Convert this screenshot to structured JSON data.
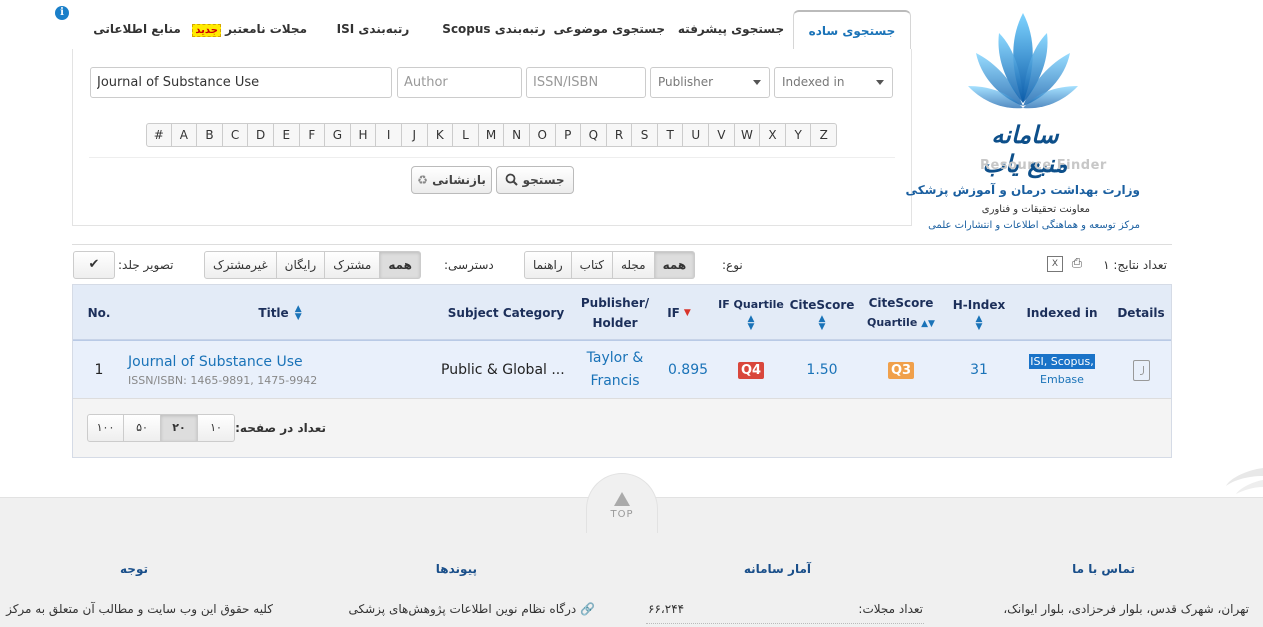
{
  "tabs": [
    {
      "label": "جستجوی ساده",
      "active": true
    },
    {
      "label": "جستجوی پیشرفته"
    },
    {
      "label": "جستجوی موضوعی"
    },
    {
      "label": "رتبه‌بندی Scopus"
    },
    {
      "label": "رتبه‌بندی ISI"
    },
    {
      "label": "مجلات نامعتبر",
      "badge": "جدید"
    },
    {
      "label": "منابع اطلاعاتی"
    }
  ],
  "search": {
    "title_value": "Journal of Substance Use",
    "author_placeholder": "Author",
    "issn_placeholder": "ISSN/ISBN",
    "publisher_label": "Publisher",
    "indexed_label": "Indexed in",
    "alphabet": [
      "#",
      "A",
      "B",
      "C",
      "D",
      "E",
      "F",
      "G",
      "H",
      "I",
      "J",
      "K",
      "L",
      "M",
      "N",
      "O",
      "P",
      "Q",
      "R",
      "S",
      "T",
      "U",
      "V",
      "W",
      "X",
      "Y",
      "Z"
    ],
    "search_button": "جستجو",
    "reset_button": "بازنشانی"
  },
  "logo": {
    "title": "سامانه منبع یاب",
    "english": "Resource Finder",
    "line1": "وزارت بهداشت درمان و آموزش پزشکی",
    "line2": "معاونت تحقیقات و فناوری",
    "line3": "مرکز توسعه و هماهنگی اطلاعات و انتشارات علمی"
  },
  "filters": {
    "result_count_label": "تعداد نتایج: ۱",
    "type_label": "نوع:",
    "type_options": [
      "راهنما",
      "کتاب",
      "مجله",
      "همه"
    ],
    "type_selected": "همه",
    "access_label": "دسترسی:",
    "access_options": [
      "غیرمشترک",
      "رایگان",
      "مشترک",
      "همه"
    ],
    "access_selected": "همه",
    "cover_label": "تصویر جلد:"
  },
  "table": {
    "headers": {
      "no": "No.",
      "title": "Title",
      "subject": "Subject Category",
      "publisher": "Publisher/ Holder",
      "if": "IF",
      "if_quartile": "IF Quartile",
      "citescore": "CiteScore",
      "citescore_quartile_1": "CiteScore",
      "citescore_quartile_2": "Quartile",
      "hindex": "H-Index",
      "indexed": "Indexed in",
      "details": "Details"
    },
    "rows": [
      {
        "no": "1",
        "title": "Journal of Substance Use",
        "issn": "ISSN/ISBN: 1465-9891, 1475-9942",
        "subject": "Public & Global ...",
        "publisher_1": "Taylor &",
        "publisher_2": "Francis",
        "if": "0.895",
        "if_quartile": "Q4",
        "citescore": "1.50",
        "citescore_quartile": "Q3",
        "hindex": "31",
        "indexed_1": "ISI, Scopus,",
        "indexed_2": "Embase"
      }
    ],
    "page_size_label": "تعداد در صفحه:",
    "page_sizes": [
      "۱۰۰",
      "۵۰",
      "۲۰",
      "۱۰"
    ],
    "page_size_selected": "۲۰"
  },
  "footer": {
    "top_label": "TOP",
    "contact_heading": "تماس با ما",
    "contact_text": "تهران، شهرک قدس، بلوار فرحزادی، بلوار ایوانک،",
    "stats_heading": "آمار سامانه",
    "stats_label": "تعداد مجلات:",
    "stats_value": "۶۶،۲۴۴",
    "links_heading": "پیوندها",
    "links_text": "درگاه نظام نوین اطلاعات پژوهش‌های پزشکی",
    "notice_heading": "توجه",
    "notice_text": "کلیه حقوق این وب سایت و مطالب آن متعلق به مرکز"
  },
  "colors": {
    "accent": "#1a73b8",
    "header_bg": "#e3ebf7",
    "row_bg": "#e9f0fb",
    "q4": "#d9473c",
    "q3": "#f0a04b"
  }
}
